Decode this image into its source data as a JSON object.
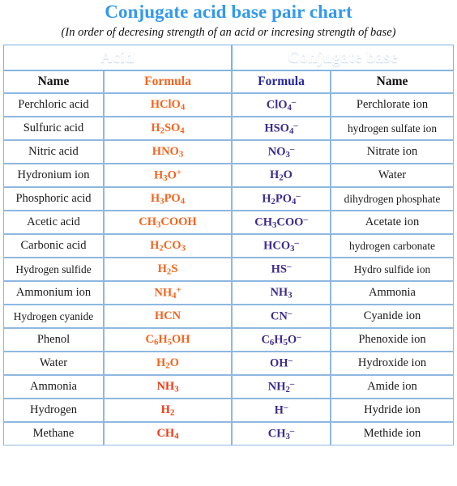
{
  "header": {
    "title": "Conjugate acid base pair chart",
    "subtitle": "(In order of decresing strength of an acid or incresing strength of base)",
    "title_color": "#3399ee"
  },
  "table": {
    "group_headers": [
      {
        "label": "Acid",
        "colspan": 2
      },
      {
        "label": "Conjugate base",
        "colspan": 2
      }
    ],
    "column_headers": [
      {
        "label": "Name",
        "color": "#111111"
      },
      {
        "label": "Formula",
        "color": "#f4641e"
      },
      {
        "label": "Formula",
        "color": "#26289c"
      },
      {
        "label": "Name",
        "color": "#111111"
      }
    ],
    "colors": {
      "acid_formula": "#f4641e",
      "acid_formula_alt": "#f03a14",
      "base_formula": "#3b2c8c",
      "header_band_top": "#8ed2fa",
      "header_band_bottom": "#6fb3e8",
      "border": "#8fb8e0"
    },
    "rows": [
      {
        "acid_name": "Perchloric acid",
        "acid_formula": "HClO4",
        "acid_formula_html": "HClO<sub>4</sub>",
        "base_formula": "ClO4-",
        "base_formula_html": "ClO<sub>4</sub><sup>&ndash;</sup>",
        "base_name": "Perchlorate ion"
      },
      {
        "acid_name": "Sulfuric acid",
        "acid_formula": "H2SO4",
        "acid_formula_html": "H<sub>2</sub>SO<sub>4</sub>",
        "base_formula": "HSO4-",
        "base_formula_html": "HSO<sub>4</sub><sup>&ndash;</sup>",
        "base_name": "hydrogen sulfate ion"
      },
      {
        "acid_name": "Nitric acid",
        "acid_formula": "HNO3",
        "acid_formula_html": "HNO<sub>3</sub>",
        "base_formula": "NO3-",
        "base_formula_html": "NO<sub>3</sub><sup>&ndash;</sup>",
        "base_name": "Nitrate ion"
      },
      {
        "acid_name": "Hydronium ion",
        "acid_formula": "H3O+",
        "acid_formula_html": "H<sub>3</sub>O<sup>+</sup>",
        "base_formula": "H2O",
        "base_formula_html": "H<sub>2</sub>O",
        "base_name": "Water"
      },
      {
        "acid_name": "Phosphoric acid",
        "acid_formula": "H3PO4",
        "acid_formula_html": "H<sub>3</sub>PO<sub>4</sub>",
        "base_formula": "H2PO4-",
        "base_formula_html": "H<sub>2</sub>PO<sub>4</sub><sup>&ndash;</sup>",
        "base_name": "dihydrogen phosphate"
      },
      {
        "acid_name": "Acetic acid",
        "acid_formula": "CH3COOH",
        "acid_formula_html": "CH<sub>3</sub>COOH",
        "base_formula": "CH3COO-",
        "base_formula_html": "CH<sub>3</sub>COO<sup>&ndash;</sup>",
        "base_name": "Acetate ion"
      },
      {
        "acid_name": "Carbonic acid",
        "acid_formula": "H2CO3",
        "acid_formula_html": "H<sub>2</sub>CO<sub>3</sub>",
        "base_formula": "HCO3-",
        "base_formula_html": "HCO<sub>3</sub><sup>&ndash;</sup>",
        "base_name": "hydrogen carbonate"
      },
      {
        "acid_name": "Hydrogen sulfide",
        "acid_formula": "H2S",
        "acid_formula_html": "H<sub>2</sub>S",
        "base_formula": "HS-",
        "base_formula_html": "HS<sup>&ndash;</sup>",
        "base_name": "Hydro sulfide ion"
      },
      {
        "acid_name": "Ammonium ion",
        "acid_formula": "NH4+",
        "acid_formula_html": "NH<sub>4</sub><sup>+</sup>",
        "base_formula": "NH3",
        "base_formula_html": "NH<sub>3</sub>",
        "base_name": "Ammonia"
      },
      {
        "acid_name": "Hydrogen cyanide",
        "acid_formula": "HCN",
        "acid_formula_html": "HCN",
        "base_formula": "CN-",
        "base_formula_html": "CN<sup>&ndash;</sup>",
        "base_name": "Cyanide ion"
      },
      {
        "acid_name": "Phenol",
        "acid_formula": "C6H5OH",
        "acid_formula_html": "C<sub>6</sub>H<sub>5</sub>OH",
        "base_formula": "C6H5O-",
        "base_formula_html": "C<sub>6</sub>H<sub>5</sub>O<sup>&ndash;</sup>",
        "base_name": "Phenoxide ion"
      },
      {
        "acid_name": "Water",
        "acid_formula": "H2O",
        "acid_formula_html": "H<sub>2</sub>O",
        "base_formula": "OH-",
        "base_formula_html": "OH<sup>&ndash;</sup>",
        "base_name": "Hydroxide ion"
      },
      {
        "acid_name": "Ammonia",
        "acid_formula": "NH3",
        "acid_formula_html": "NH<sub>3</sub>",
        "base_formula": "NH2-",
        "base_formula_html": "NH<sub>2</sub><sup>&ndash;</sup>",
        "base_name": "Amide ion",
        "acid_formula_alt_color": true
      },
      {
        "acid_name": "Hydrogen",
        "acid_formula": "H2",
        "acid_formula_html": "H<sub>2</sub>",
        "base_formula": "H-",
        "base_formula_html": "H<sup>&ndash;</sup>",
        "base_name": "Hydride ion",
        "acid_formula_alt_color": true
      },
      {
        "acid_name": "Methane",
        "acid_formula": "CH4",
        "acid_formula_html": "CH<sub>4</sub>",
        "base_formula": "CH3-",
        "base_formula_html": "CH<sub>3</sub><sup>&ndash;</sup>",
        "base_name": "Methide ion",
        "acid_formula_alt_color": true
      }
    ]
  }
}
